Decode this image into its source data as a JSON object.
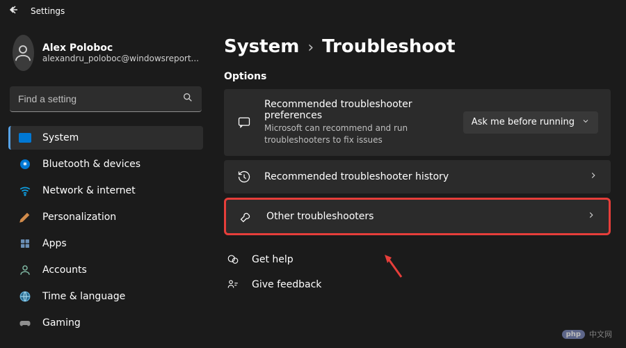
{
  "app_title": "Settings",
  "user": {
    "name": "Alex Poloboc",
    "email": "alexandru_poloboc@windowsreport..."
  },
  "search": {
    "placeholder": "Find a setting"
  },
  "sidebar": {
    "items": [
      {
        "label": "System",
        "active": true
      },
      {
        "label": "Bluetooth & devices"
      },
      {
        "label": "Network & internet"
      },
      {
        "label": "Personalization"
      },
      {
        "label": "Apps"
      },
      {
        "label": "Accounts"
      },
      {
        "label": "Time & language"
      },
      {
        "label": "Gaming"
      }
    ]
  },
  "breadcrumb": {
    "parent": "System",
    "sep": "›",
    "leaf": "Troubleshoot"
  },
  "section_label": "Options",
  "cards": {
    "recommended": {
      "title": "Recommended troubleshooter preferences",
      "desc": "Microsoft can recommend and run troubleshooters to fix issues",
      "dropdown_value": "Ask me before running"
    },
    "history": {
      "title": "Recommended troubleshooter history"
    },
    "other": {
      "title": "Other troubleshooters"
    }
  },
  "help": {
    "get_help": "Get help",
    "feedback": "Give feedback"
  },
  "watermark": {
    "badge": "php",
    "text": "中文网"
  }
}
